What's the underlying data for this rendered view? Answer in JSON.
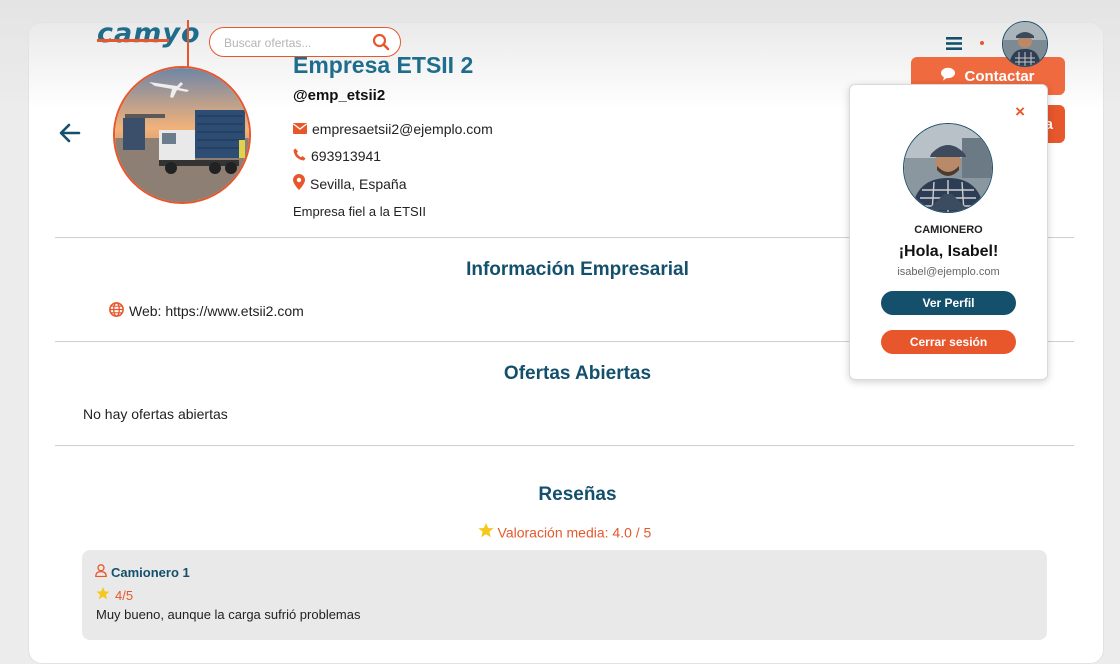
{
  "colors": {
    "accent": "#e8572c",
    "primary": "#14506c",
    "title_blue": "#1e6d8d",
    "review_bg": "#e9e9e9"
  },
  "header": {
    "logo_text": "camyo",
    "search_placeholder": "Buscar ofertas...",
    "icons": [
      "search-icon",
      "hamburger-menu-icon",
      "user-avatar"
    ]
  },
  "company": {
    "name": "Empresa ETSII 2",
    "handle": "@emp_etsii2",
    "email": "empresaetsii2@ejemplo.com",
    "phone": "693913941",
    "location": "Sevilla, España",
    "description": "Empresa fiel a la ETSII"
  },
  "actions": {
    "contact_label": "Contactar",
    "second_label_partial": "a"
  },
  "business_info": {
    "title": "Información Empresarial",
    "web_label": "Web: https://www.etsii2.com"
  },
  "offers": {
    "title": "Ofertas Abiertas",
    "empty_text": "No hay ofertas abiertas"
  },
  "reviews": {
    "title": "Reseñas",
    "average_label": "Valoración media: 4.0 / 5",
    "items": [
      {
        "author": "Camionero 1",
        "score": "4/5",
        "text": "Muy bueno, aunque la carga sufrió problemas"
      }
    ]
  },
  "user_popup": {
    "close_glyph": "×",
    "role": "CAMIONERO",
    "greeting": "¡Hola, Isabel!",
    "email": "isabel@ejemplo.com",
    "profile_button": "Ver Perfil",
    "logout_button": "Cerrar sesión"
  }
}
